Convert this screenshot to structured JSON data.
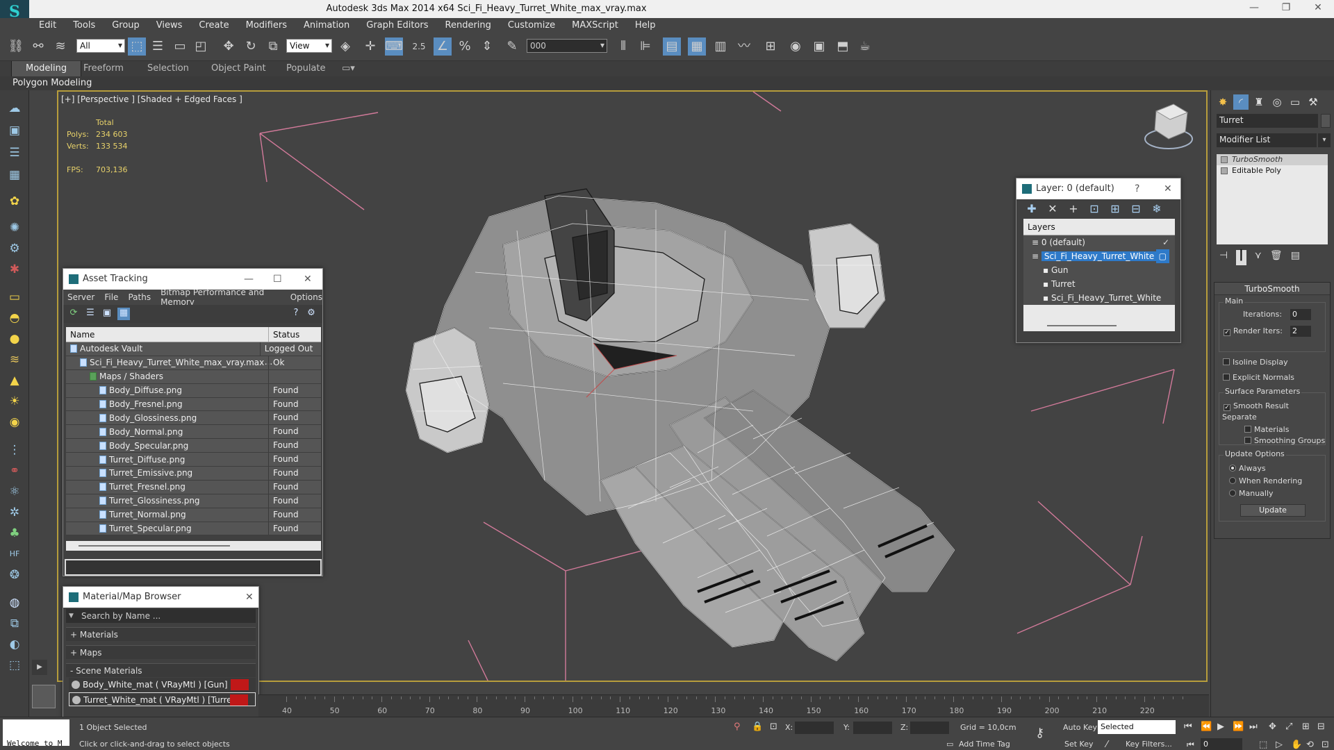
{
  "window": {
    "title": "Autodesk 3ds Max  2014 x64     Sci_Fi_Heavy_Turret_White_max_vray.max",
    "minimize": "—",
    "maximize": "❐",
    "close": "✕"
  },
  "menu": [
    "Edit",
    "Tools",
    "Group",
    "Views",
    "Create",
    "Modifiers",
    "Animation",
    "Graph Editors",
    "Rendering",
    "Customize",
    "MAXScript",
    "Help"
  ],
  "toolbar": {
    "selection_filter": "All",
    "reference_coord": "View",
    "snap_value": "2.5",
    "named_selection": "000"
  },
  "ribbon": {
    "tabs": [
      "Modeling",
      "Freeform",
      "Selection",
      "Object Paint",
      "Populate"
    ],
    "active_tab": "Modeling",
    "sub_label": "Polygon Modeling"
  },
  "viewport": {
    "label": "[+] [Perspective ] [Shaded + Edged Faces ]",
    "stats_header": "Total",
    "polys_label": "Polys:",
    "polys_value": "234 603",
    "verts_label": "Verts:",
    "verts_value": "133 534",
    "fps_label": "FPS:",
    "fps_value": "703,136"
  },
  "asset_tracking": {
    "title": "Asset Tracking",
    "menu": [
      "Server",
      "File",
      "Paths",
      "Bitmap Performance and Memory",
      "Options"
    ],
    "col_name": "Name",
    "col_status": "Status",
    "rows": [
      {
        "name": "Autodesk Vault",
        "status": "Logged Out ...",
        "indent": 1
      },
      {
        "name": "Sci_Fi_Heavy_Turret_White_max_vray.max",
        "status": "Ok",
        "indent": 2
      },
      {
        "name": "Maps / Shaders",
        "status": "",
        "indent": 3
      },
      {
        "name": "Body_Diffuse.png",
        "status": "Found",
        "indent": 4
      },
      {
        "name": "Body_Fresnel.png",
        "status": "Found",
        "indent": 4
      },
      {
        "name": "Body_Glossiness.png",
        "status": "Found",
        "indent": 4
      },
      {
        "name": "Body_Normal.png",
        "status": "Found",
        "indent": 4
      },
      {
        "name": "Body_Specular.png",
        "status": "Found",
        "indent": 4
      },
      {
        "name": "Turret_Diffuse.png",
        "status": "Found",
        "indent": 4
      },
      {
        "name": "Turret_Emissive.png",
        "status": "Found",
        "indent": 4
      },
      {
        "name": "Turret_Fresnel.png",
        "status": "Found",
        "indent": 4
      },
      {
        "name": "Turret_Glossiness.png",
        "status": "Found",
        "indent": 4
      },
      {
        "name": "Turret_Normal.png",
        "status": "Found",
        "indent": 4
      },
      {
        "name": "Turret_Specular.png",
        "status": "Found",
        "indent": 4
      }
    ]
  },
  "material_browser": {
    "title": "Material/Map Browser",
    "search_placeholder": "Search by Name ...",
    "sections": [
      "+ Materials",
      "+ Maps",
      "- Scene Materials"
    ],
    "materials": [
      {
        "label": "Body_White_mat  ( VRayMtl )  [Gun]",
        "color": "#c01818"
      },
      {
        "label": "Turret_White_mat  ( VRayMtl )  [Turret]",
        "color": "#c01818"
      }
    ]
  },
  "layer_dialog": {
    "title": "Layer: 0 (default)",
    "help": "?",
    "header": "Layers",
    "rows": [
      {
        "label": "0 (default)",
        "indent": 1,
        "selected": false,
        "mark": "✓"
      },
      {
        "label": "Sci_Fi_Heavy_Turret_White",
        "indent": 1,
        "selected": true,
        "mark": "▢"
      },
      {
        "label": "Gun",
        "indent": 2,
        "selected": false,
        "mark": ""
      },
      {
        "label": "Turret",
        "indent": 2,
        "selected": false,
        "mark": ""
      },
      {
        "label": "Sci_Fi_Heavy_Turret_White",
        "indent": 2,
        "selected": false,
        "mark": ""
      }
    ]
  },
  "command_panel": {
    "object_name": "Turret",
    "modifier_list": "Modifier List",
    "stack": [
      "TurboSmooth",
      "Editable Poly"
    ],
    "turbosmooth": {
      "header": "TurboSmooth",
      "main_label": "Main",
      "iterations_label": "Iterations:",
      "iterations_value": "0",
      "render_iters_label": "Render Iters:",
      "render_iters_value": "2",
      "isoline_label": "Isoline Display",
      "explicit_normals_label": "Explicit Normals",
      "surface_label": "Surface Parameters",
      "smooth_result_label": "Smooth Result",
      "separate_label": "Separate",
      "materials_label": "Materials",
      "smoothing_groups_label": "Smoothing Groups",
      "update_options_label": "Update Options",
      "always_label": "Always",
      "when_rendering_label": "When Rendering",
      "manually_label": "Manually",
      "update_button": "Update"
    }
  },
  "timeline": {
    "ticks": [
      "40",
      "50",
      "60",
      "70",
      "80",
      "90",
      "100",
      "110",
      "120",
      "130",
      "140",
      "150",
      "160",
      "170",
      "180",
      "190",
      "200",
      "210",
      "220"
    ]
  },
  "statusbar": {
    "selected_text": "1 Object Selected",
    "prompt_text": "Click or click-and-drag to select objects",
    "x_label": "X:",
    "y_label": "Y:",
    "z_label": "Z:",
    "grid_text": "Grid = 10,0cm",
    "add_time_tag": "Add Time Tag",
    "auto_key": "Auto Key",
    "set_key": "Set Key",
    "selected_dropdown": "Selected",
    "key_filters": "Key Filters...",
    "frame_value": "0",
    "welcome": "Welcome to M"
  }
}
